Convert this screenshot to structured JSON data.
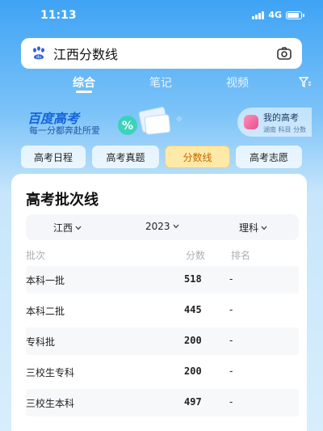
{
  "status": {
    "time": "11:13",
    "network": "4G"
  },
  "search": {
    "query": "江西分数线",
    "left_icon": "baidu-paw-icon",
    "right_icon": "camera-icon"
  },
  "tabs": [
    {
      "label": "综合",
      "active": true
    },
    {
      "label": "笔记",
      "active": false
    },
    {
      "label": "视频",
      "active": false
    }
  ],
  "banner": {
    "title": "百度高考",
    "subtitle": "每一分都奔赴所爱",
    "my_exam": {
      "label": "我的高考",
      "meta": "湖南 科目 分数"
    }
  },
  "chips": [
    {
      "label": "高考日程",
      "active": false
    },
    {
      "label": "高考真题",
      "active": false
    },
    {
      "label": "分数线",
      "active": true
    },
    {
      "label": "高考志愿",
      "active": false
    }
  ],
  "card": {
    "title": "高考批次线",
    "filters": {
      "province": "江西",
      "year": "2023",
      "subject": "理科"
    },
    "headers": {
      "batch": "批次",
      "score": "分数",
      "rank": "排名"
    },
    "rows": [
      {
        "batch": "本科一批",
        "score": "518",
        "rank": "-"
      },
      {
        "batch": "本科二批",
        "score": "445",
        "rank": "-"
      },
      {
        "batch": "专科批",
        "score": "200",
        "rank": "-"
      },
      {
        "batch": "三校生专科",
        "score": "200",
        "rank": "-"
      },
      {
        "batch": "三校生本科",
        "score": "497",
        "rank": "-"
      }
    ]
  },
  "colors": {
    "accent": "#1565d8",
    "active_chip_bg": "#ffe9a8",
    "active_chip_text": "#c06a00"
  }
}
